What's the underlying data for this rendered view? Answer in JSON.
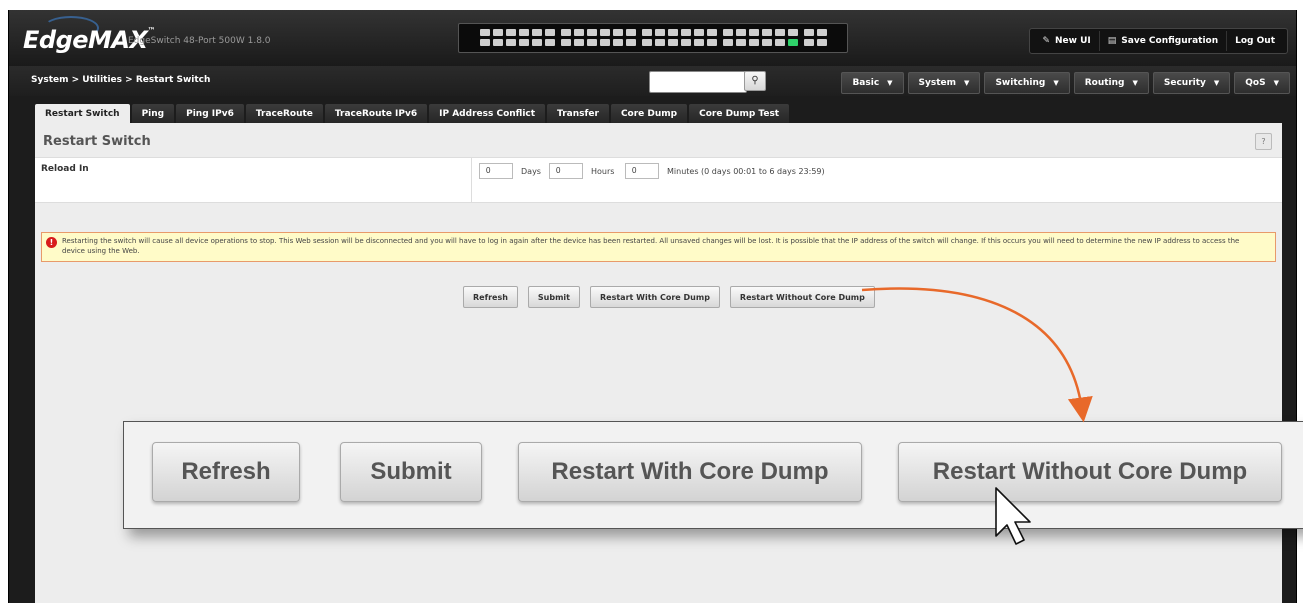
{
  "header": {
    "logo": "EdgeMAX",
    "logo_tm": "™",
    "model": "EdgeSwitch 48-Port 500W 1.8.0",
    "buttons": [
      {
        "label": "New UI",
        "icon": "pencil-icon"
      },
      {
        "label": "Save Configuration",
        "icon": "save-icon"
      },
      {
        "label": "Log Out"
      }
    ]
  },
  "nav": {
    "breadcrumb": "System > Utilities > Restart Switch",
    "search": {
      "value": "",
      "placeholder": ""
    },
    "menus": [
      "Basic",
      "System",
      "Switching",
      "Routing",
      "Security",
      "QoS"
    ]
  },
  "tabs": [
    "Restart Switch",
    "Ping",
    "Ping IPv6",
    "TraceRoute",
    "TraceRoute IPv6",
    "IP Address Conflict",
    "Transfer",
    "Core Dump",
    "Core Dump Test"
  ],
  "active_tab": "Restart Switch",
  "panel": {
    "title": "Restart Switch",
    "help": "?",
    "reload_label": "Reload In",
    "days_value": "0",
    "days_label": "Days",
    "hours_value": "0",
    "hours_label": "Hours",
    "minutes_value": "0",
    "minutes_label": "Minutes  (0 days 00:01 to 6 days 23:59)",
    "warning": "Restarting the switch will cause all device operations to stop. This Web session will be disconnected and you will have to log in again after the device has been restarted. All unsaved changes will be lost. It is possible that the IP address of the switch will change. If this occurs you will need to determine the new IP address to access the device using the Web."
  },
  "actions": [
    "Refresh",
    "Submit",
    "Restart With Core Dump",
    "Restart Without Core Dump"
  ],
  "colors": {
    "arrow": "#e8692a",
    "warning_bg": "#fffbc8",
    "warning_icon": "#d81c1c"
  }
}
